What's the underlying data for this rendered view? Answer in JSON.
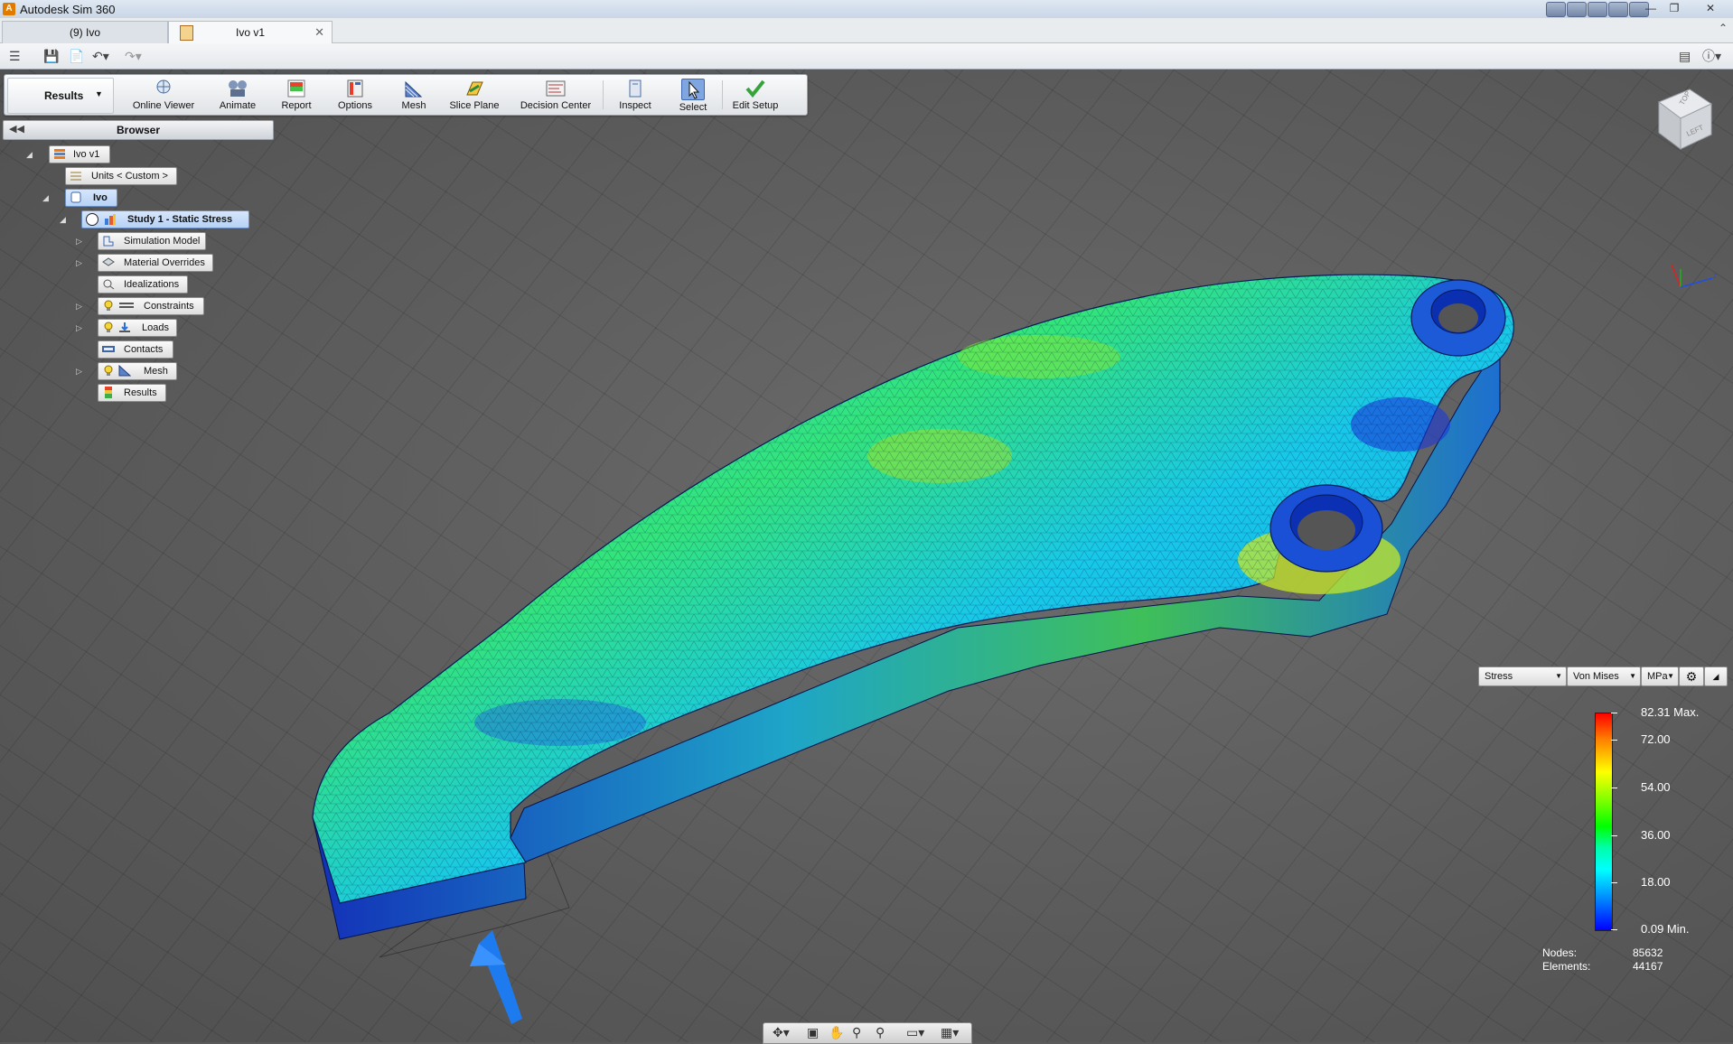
{
  "window": {
    "title": "Autodesk Sim 360",
    "app_icon_letter": "A"
  },
  "tabs": [
    {
      "label": "(9) Ivo",
      "active": false
    },
    {
      "label": "Ivo v1",
      "active": true
    }
  ],
  "ribbon": {
    "workspace_label": "Results",
    "buttons": [
      {
        "label": "Online Viewer",
        "icon": "online-viewer-icon",
        "has_menu": true
      },
      {
        "label": "Animate",
        "icon": "animate-icon",
        "has_menu": false
      },
      {
        "label": "Report",
        "icon": "report-icon",
        "has_menu": false
      },
      {
        "label": "Options",
        "icon": "options-icon",
        "has_menu": true
      },
      {
        "label": "Mesh",
        "icon": "mesh-icon",
        "has_menu": true
      },
      {
        "label": "Slice Plane",
        "icon": "slice-plane-icon",
        "has_menu": false
      },
      {
        "label": "Decision Center",
        "icon": "decision-center-icon",
        "has_menu": false
      },
      {
        "label": "Inspect",
        "icon": "inspect-icon",
        "has_menu": true
      },
      {
        "label": "Select",
        "icon": "select-icon",
        "has_menu": true
      },
      {
        "label": "Edit Setup",
        "icon": "edit-setup-icon",
        "has_menu": false
      }
    ]
  },
  "browser": {
    "title": "Browser",
    "nodes": {
      "root": "Ivo v1",
      "units": "Units < Custom >",
      "component": "Ivo",
      "study": "Study 1 - Static Stress",
      "simulation_model": "Simulation Model",
      "material_overrides": "Material Overrides",
      "idealizations": "Idealizations",
      "constraints": "Constraints",
      "loads": "Loads",
      "contacts": "Contacts",
      "mesh": "Mesh",
      "results": "Results"
    }
  },
  "viewcube": {
    "top_label": "TOP",
    "left_label": "LEFT"
  },
  "legend": {
    "result_type": "Stress",
    "component": "Von Mises",
    "unit": "MPa",
    "max_label": "82.31 Max.",
    "min_label": "0.09 Min.",
    "ticks": [
      "72.00",
      "54.00",
      "36.00",
      "18.00"
    ],
    "colors": [
      "#ff0000",
      "#ffff00",
      "#00ff00",
      "#00ffff",
      "#0000ff"
    ]
  },
  "stats": {
    "nodes_label": "Nodes:",
    "nodes_value": "85632",
    "elements_label": "Elements:",
    "elements_value": "44167"
  }
}
